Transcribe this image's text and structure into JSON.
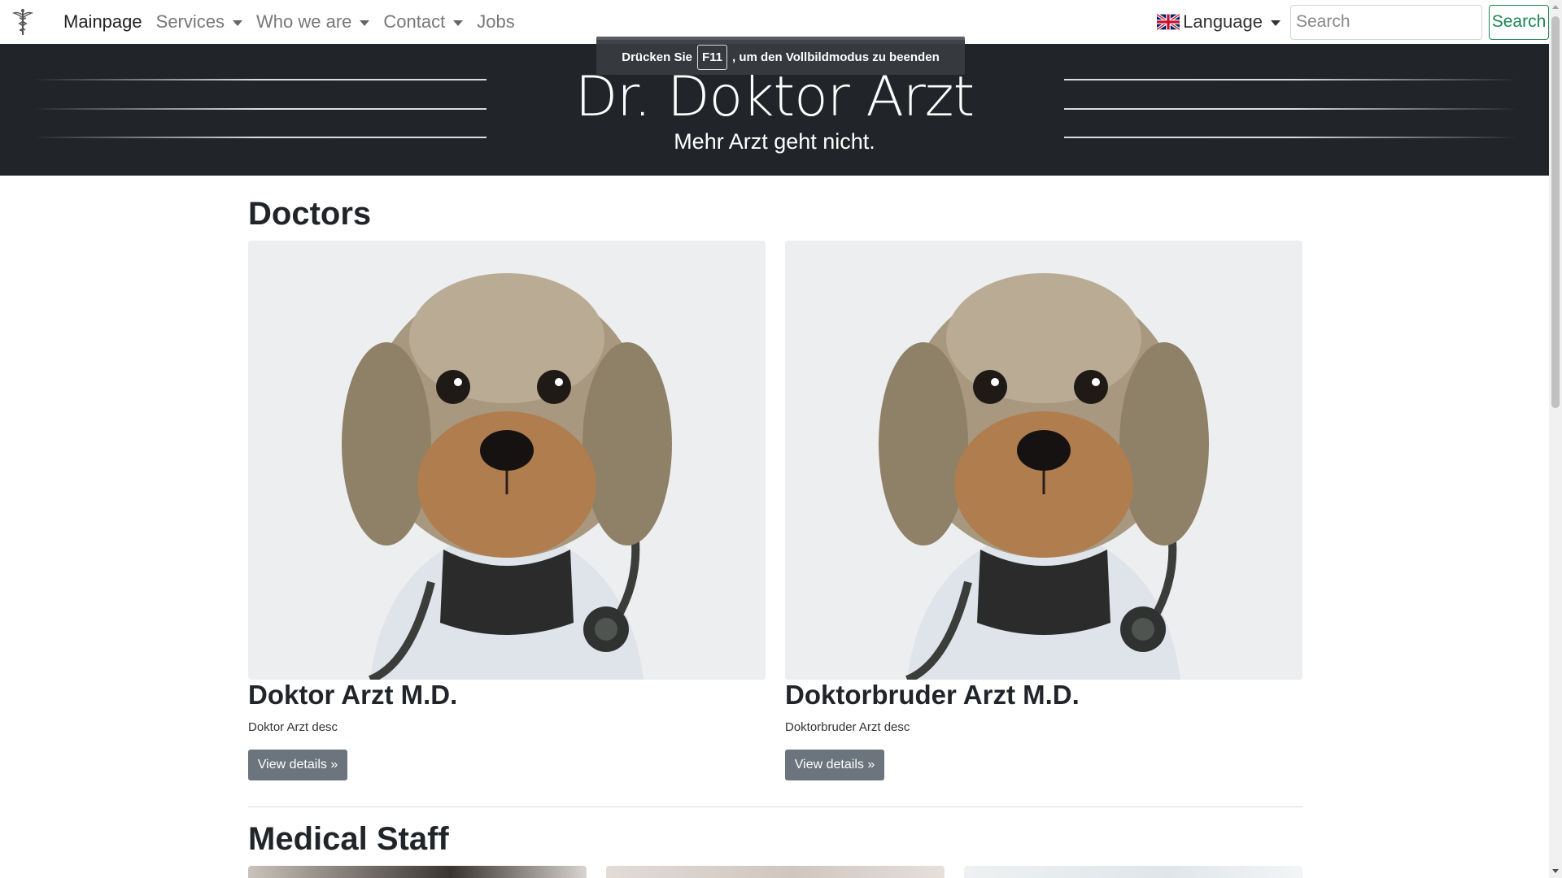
{
  "navbar": {
    "items": [
      {
        "label": "Mainpage",
        "active": true,
        "dropdown": false
      },
      {
        "label": "Services",
        "active": false,
        "dropdown": true
      },
      {
        "label": "Who we are",
        "active": false,
        "dropdown": true
      },
      {
        "label": "Contact",
        "active": false,
        "dropdown": true
      },
      {
        "label": "Jobs",
        "active": false,
        "dropdown": false
      }
    ],
    "language_label": "Language",
    "search_placeholder": "Search",
    "search_button": "Search"
  },
  "hero": {
    "title": "Dr. Doktor Arzt",
    "subtitle": "Mehr Arzt geht nicht."
  },
  "fullscreen_notice": {
    "prefix": "Drücken Sie",
    "key": "F11",
    "suffix": ", um den Vollbildmodus zu beenden"
  },
  "doctors": {
    "heading": "Doctors",
    "cards": [
      {
        "name": "Doktor Arzt M.D.",
        "desc": "Doktor Arzt desc",
        "button": "View details »"
      },
      {
        "name": "Doktorbruder Arzt M.D.",
        "desc": "Doktorbruder Arzt desc",
        "button": "View details »"
      }
    ]
  },
  "medical_staff": {
    "heading": "Medical Staff"
  },
  "colors": {
    "hero_bg": "#212529",
    "success": "#198754",
    "secondary_button": "#6c757d"
  }
}
